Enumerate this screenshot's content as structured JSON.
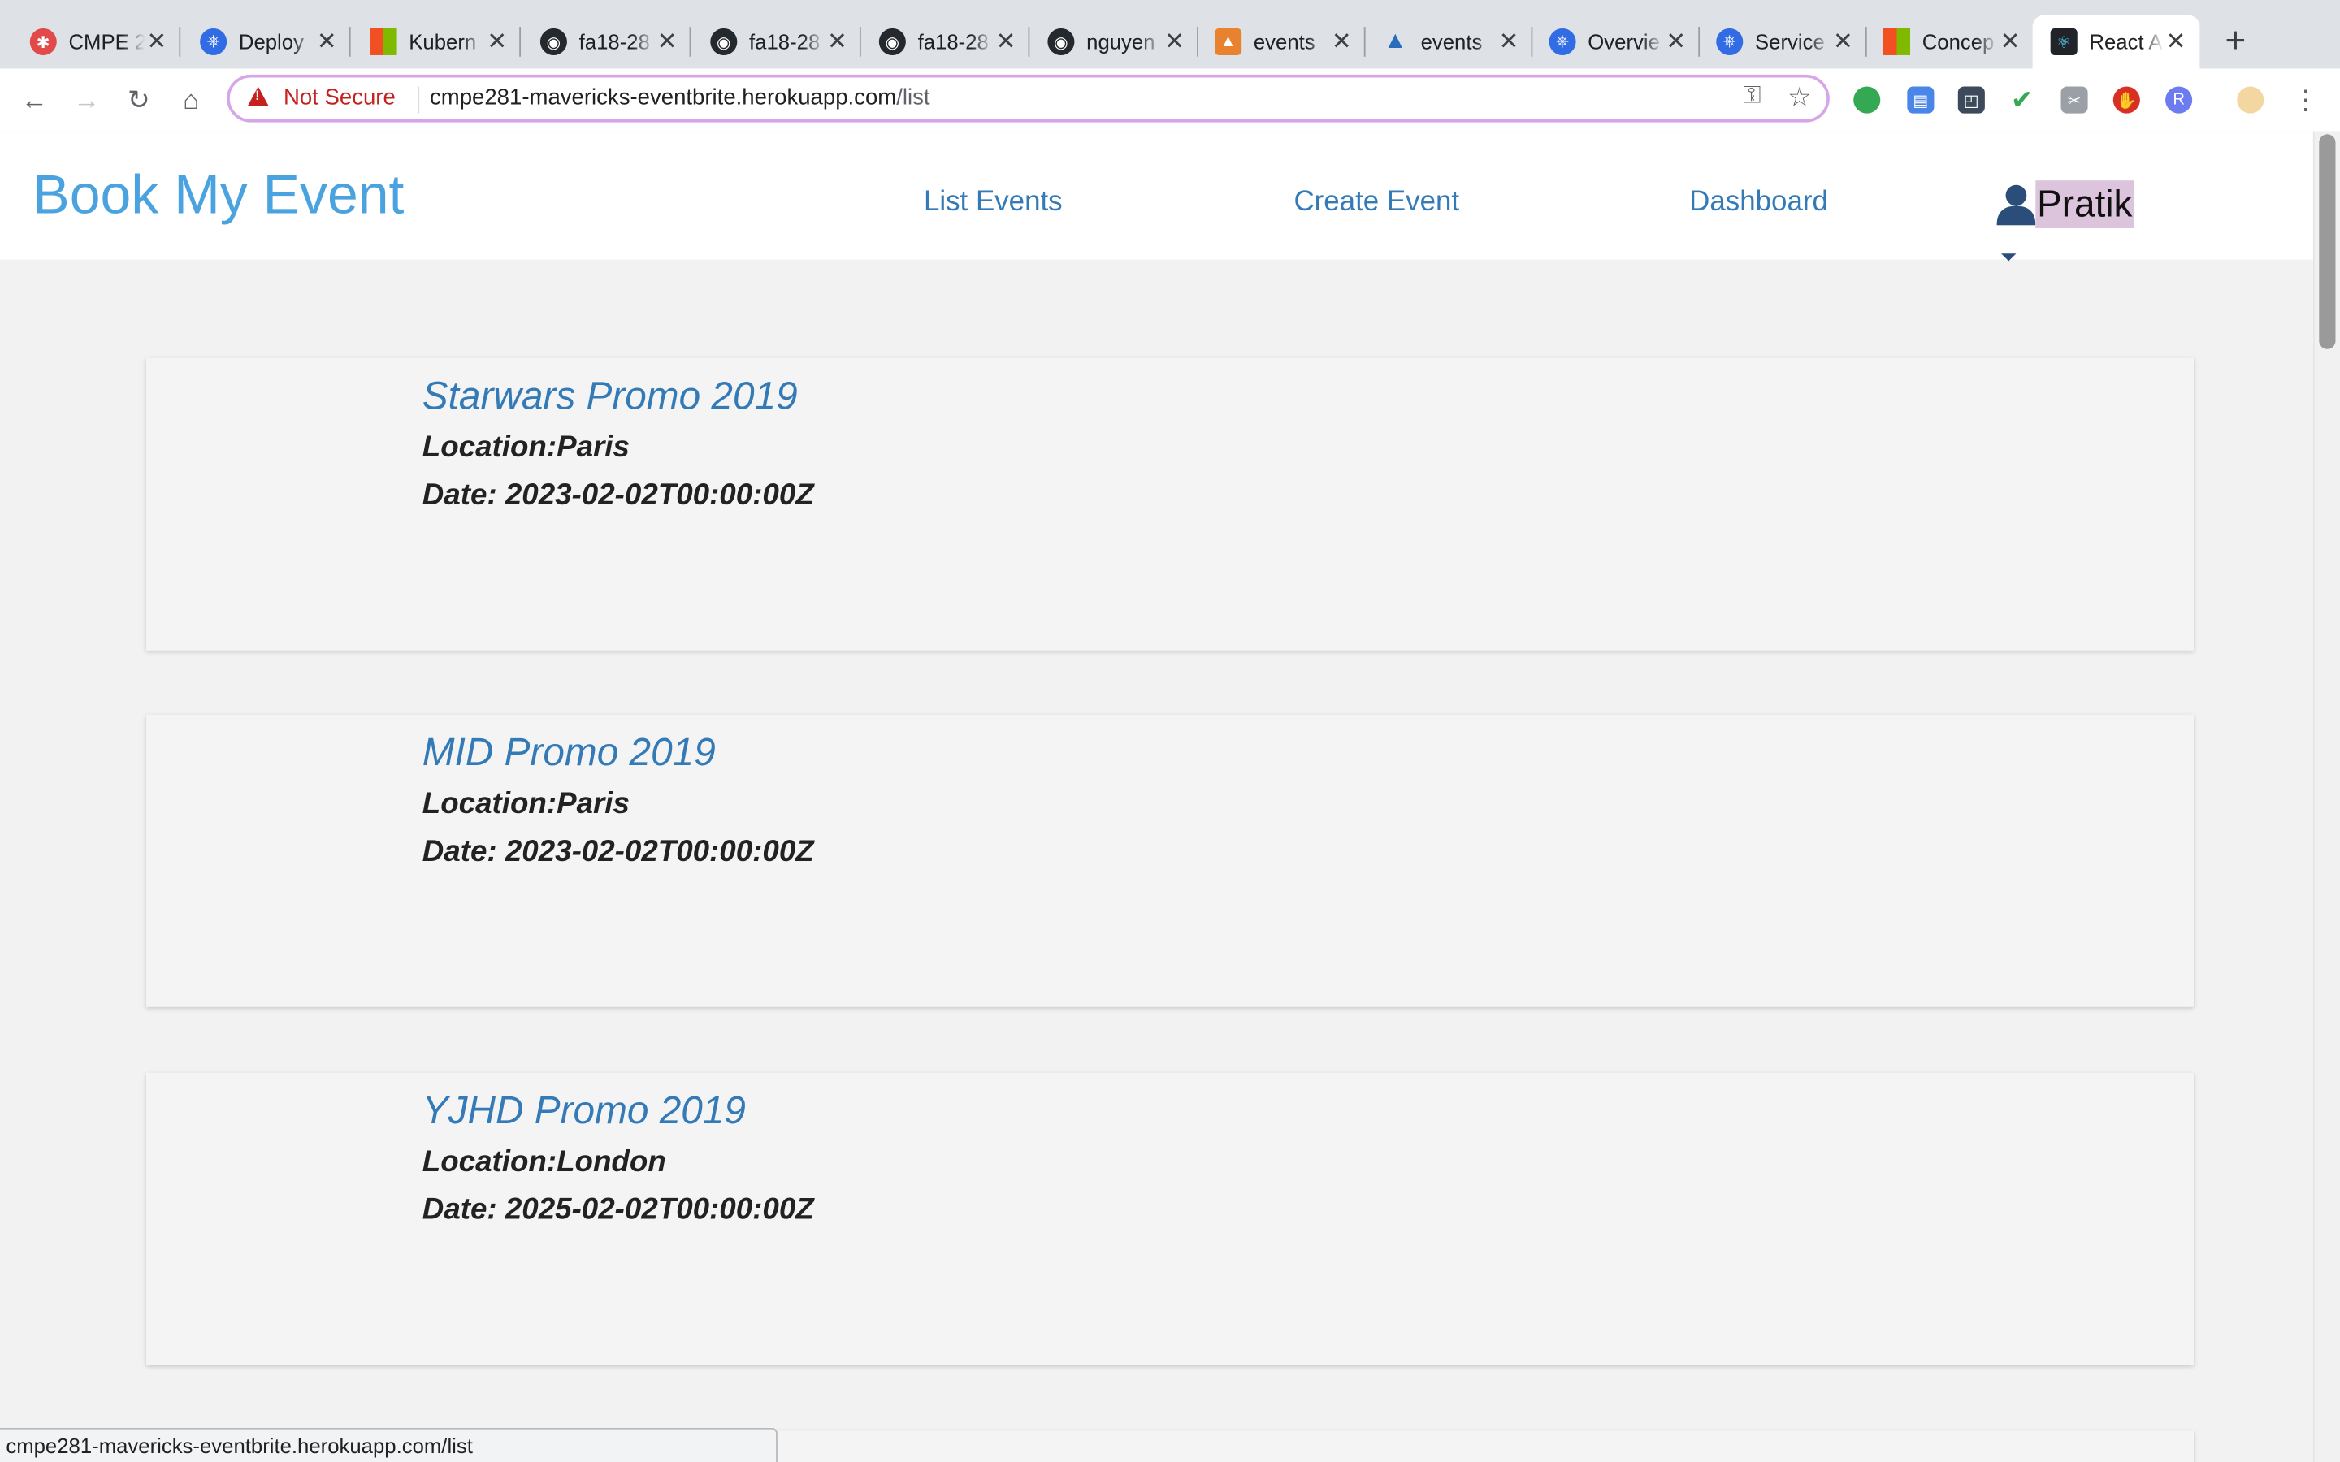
{
  "browser": {
    "tabs": [
      {
        "title": "CMPE 2",
        "icon": "cmpe-icon",
        "color": "#e24a4a"
      },
      {
        "title": "Deploy",
        "icon": "kubernetes-icon",
        "color": "#326ce5"
      },
      {
        "title": "Kubern",
        "icon": "microsoft-icon",
        "color": "#f25022"
      },
      {
        "title": "fa18-28",
        "icon": "github-icon",
        "color": "#24292e"
      },
      {
        "title": "fa18-28",
        "icon": "github-icon",
        "color": "#24292e"
      },
      {
        "title": "fa18-28",
        "icon": "github-icon",
        "color": "#24292e"
      },
      {
        "title": "nguyen",
        "icon": "github-icon",
        "color": "#24292e"
      },
      {
        "title": "events",
        "icon": "events-icon",
        "color": "#e8822e"
      },
      {
        "title": "events",
        "icon": "azure-icon",
        "color": "#2a6ebb"
      },
      {
        "title": "Overvie",
        "icon": "kubernetes-icon",
        "color": "#326ce5"
      },
      {
        "title": "Service",
        "icon": "kubernetes-icon",
        "color": "#326ce5"
      },
      {
        "title": "Concep",
        "icon": "microsoft-icon",
        "color": "#f25022"
      },
      {
        "title": "React A",
        "icon": "react-icon",
        "color": "#20232a"
      }
    ],
    "security_label": "Not Secure",
    "url_host": "cmpe281-mavericks-eventbrite.herokuapp.com",
    "url_path": "/list",
    "status_url": "cmpe281-mavericks-eventbrite.herokuapp.com/list"
  },
  "navbar": {
    "brand": "Book My Event",
    "links": [
      "List Events",
      "Create Event",
      "Dashboard"
    ],
    "user_name": "Pratik"
  },
  "events": [
    {
      "title": "Starwars Promo 2019",
      "location": "Location:Paris",
      "date": "Date: 2023-02-02T00:00:00Z"
    },
    {
      "title": "MID Promo 2019",
      "location": "Location:Paris",
      "date": "Date: 2023-02-02T00:00:00Z"
    },
    {
      "title": "YJHD Promo 2019",
      "location": "Location:London",
      "date": "Date: 2025-02-02T00:00:00Z"
    }
  ]
}
